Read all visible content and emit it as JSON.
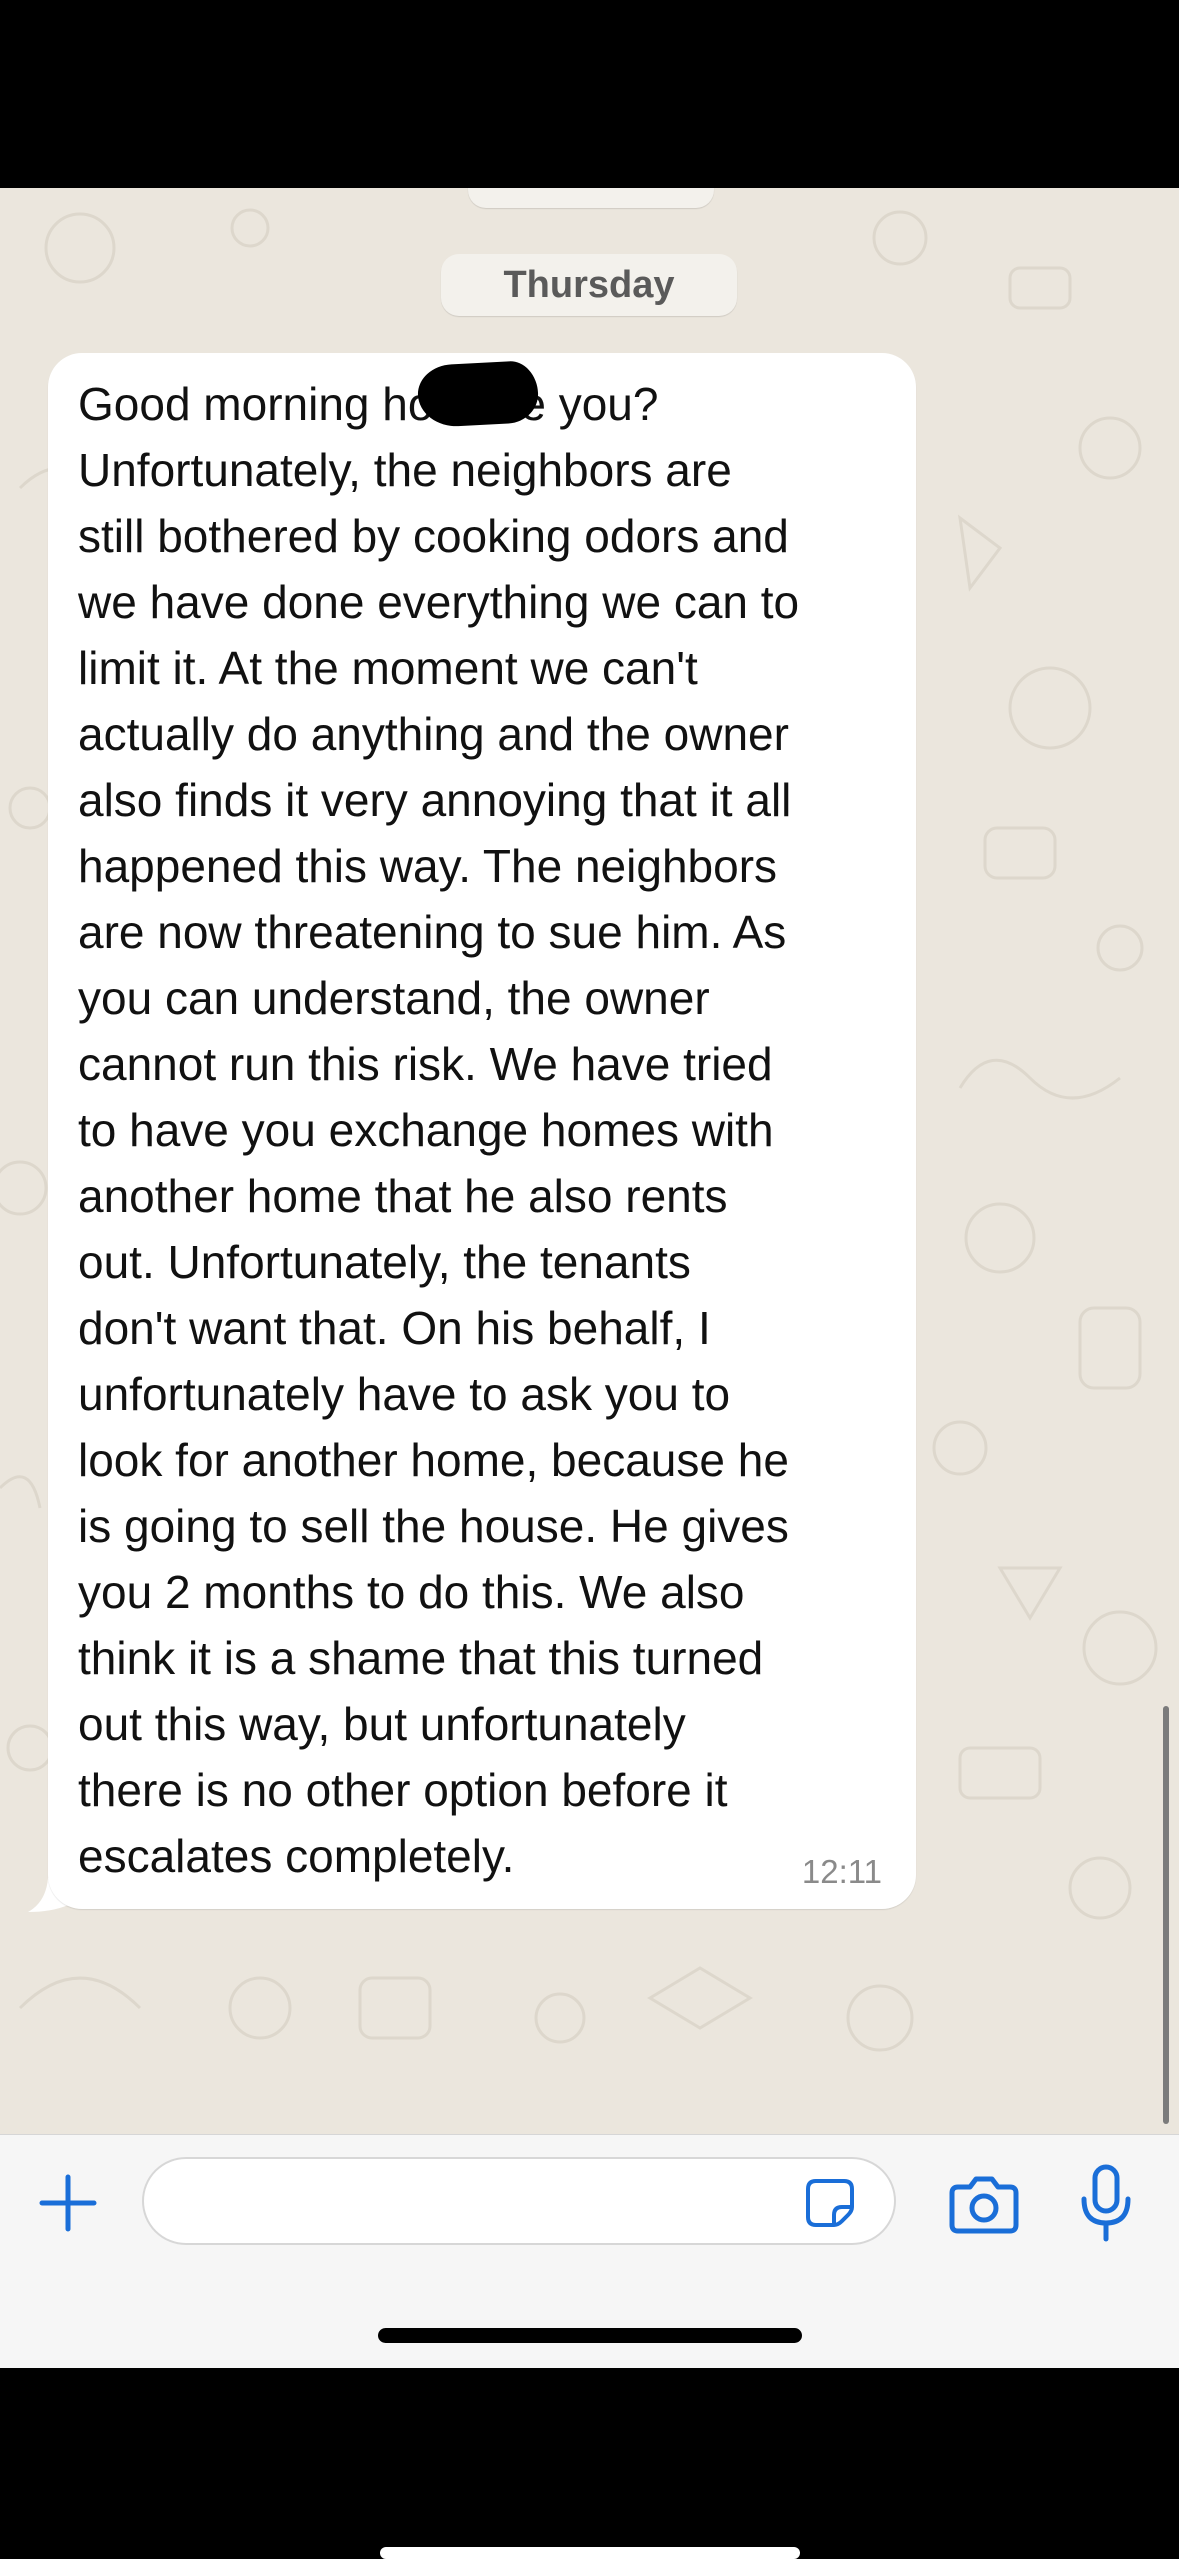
{
  "chat": {
    "date_separator": "Thursday",
    "message": {
      "text": "Good morning           how are you?\nUnfortunately, the neighbors are\nstill bothered by cooking odors and\nwe have done everything we can to\nlimit it.  At the moment we can't\nactually do anything and the owner\nalso finds it very annoying that it all\nhappened this way.  The neighbors\nare now threatening to sue him.  As\nyou can understand, the owner\ncannot run this risk.  We have tried\nto have you exchange homes with\nanother home that he also rents\nout.  Unfortunately, the tenants\ndon't want that.  On his behalf, I\nunfortunately have to ask you to\nlook for another home, because he\nis going to sell the house.  He gives\nyou 2 months to do this.  We also\nthink it is a shame that this turned\nout this way, but unfortunately\nthere is no other option before it\nescalates completely.",
      "time": "12:11",
      "direction": "incoming",
      "has_redaction": true
    }
  },
  "input_bar": {
    "placeholder": "",
    "icons": {
      "attach": "plus-icon",
      "sticker": "sticker-icon",
      "camera": "camera-icon",
      "mic": "microphone-icon"
    }
  },
  "colors": {
    "accent": "#1a6ed8",
    "chat_background": "#ebe6dd",
    "bubble": "#ffffff",
    "date_pill": "#f3f1ec"
  }
}
